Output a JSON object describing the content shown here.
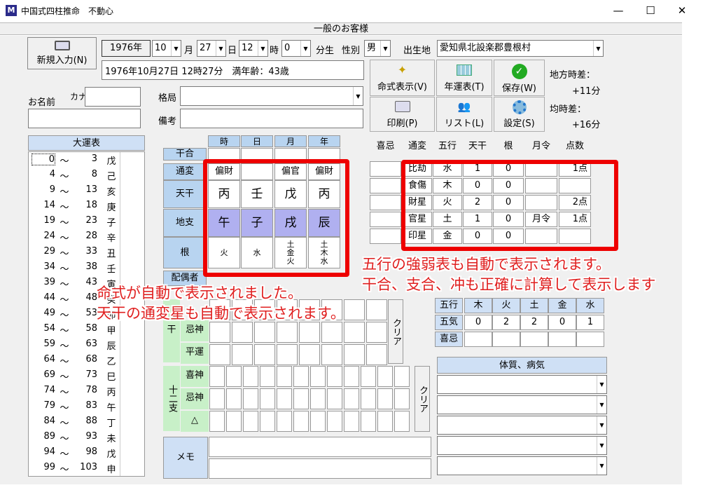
{
  "window": {
    "title": "中国式四柱推命　不動心",
    "logo": "M",
    "minimize": "—",
    "maximize": "☐",
    "close": "✕"
  },
  "header": {
    "title": "一般のお客様"
  },
  "new_button": {
    "label": "新規入力(N)"
  },
  "birth": {
    "year": "1976年",
    "month": "10",
    "month_unit": "月",
    "day": "27",
    "day_unit": "日",
    "hour": "12",
    "hour_unit": "時",
    "minute": "0",
    "minute_unit": "分生",
    "gender_label": "性別",
    "gender": "男",
    "place_label": "出生地",
    "place": "愛知県北設楽郡豊根村",
    "summary": "1976年10月27日 12時27分　満年齢：43歳"
  },
  "toolbar": {
    "meishiki": "命式表示(V)",
    "nenun": "年運表(T)",
    "save": "保存(W)",
    "print": "印刷(P)",
    "list": "リスト(L)",
    "settings": "設定(S)"
  },
  "time_diff": {
    "local_label": "地方時差：",
    "local_value": "+11分",
    "equation_label": "均時差：",
    "equation_value": "+16分"
  },
  "name": {
    "label": "お名前",
    "kana_label": "カナ",
    "kakkyoku_label": "格局",
    "biko_label": "備考"
  },
  "daiun": {
    "title": "大運表",
    "rows": [
      {
        "a": "0",
        "t": "～",
        "b": "3",
        "s": "戊"
      },
      {
        "a": "4",
        "t": "～",
        "b": "8",
        "s": "己"
      },
      {
        "a": "9",
        "t": "～",
        "b": "13",
        "s": "亥"
      },
      {
        "a": "14",
        "t": "～",
        "b": "18",
        "s": "庚"
      },
      {
        "a": "19",
        "t": "～",
        "b": "23",
        "s": "子"
      },
      {
        "a": "24",
        "t": "～",
        "b": "28",
        "s": "辛"
      },
      {
        "a": "29",
        "t": "～",
        "b": "33",
        "s": "丑"
      },
      {
        "a": "34",
        "t": "～",
        "b": "38",
        "s": "壬"
      },
      {
        "a": "39",
        "t": "～",
        "b": "43",
        "s": "寅"
      },
      {
        "a": "44",
        "t": "～",
        "b": "48",
        "s": "癸"
      },
      {
        "a": "49",
        "t": "～",
        "b": "53",
        "s": "卯"
      },
      {
        "a": "54",
        "t": "～",
        "b": "58",
        "s": "甲"
      },
      {
        "a": "59",
        "t": "～",
        "b": "63",
        "s": "辰"
      },
      {
        "a": "64",
        "t": "～",
        "b": "68",
        "s": "乙"
      },
      {
        "a": "69",
        "t": "～",
        "b": "73",
        "s": "巳"
      },
      {
        "a": "74",
        "t": "～",
        "b": "78",
        "s": "丙"
      },
      {
        "a": "79",
        "t": "～",
        "b": "83",
        "s": "午"
      },
      {
        "a": "84",
        "t": "～",
        "b": "88",
        "s": "丁"
      },
      {
        "a": "89",
        "t": "～",
        "b": "93",
        "s": "未"
      },
      {
        "a": "94",
        "t": "～",
        "b": "98",
        "s": "戊"
      },
      {
        "a": "99",
        "t": "～",
        "b": "103",
        "s": "申"
      }
    ]
  },
  "meishiki": {
    "cols": [
      "時",
      "日",
      "月",
      "年"
    ],
    "row_labels": {
      "kango": "干合",
      "tsuhen": "通変",
      "tenkan": "天干",
      "chishi": "地支",
      "kon": "根",
      "haigu": "配偶者"
    },
    "tsuhen": [
      "偏財",
      "",
      "偏官",
      "偏財"
    ],
    "tenkan": [
      "丙",
      "壬",
      "戊",
      "丙"
    ],
    "chishi": [
      "午",
      "子",
      "戌",
      "辰"
    ],
    "kon": [
      "火",
      "水",
      "土\n金\n火",
      "土\n木\n水"
    ]
  },
  "gogyo_table": {
    "headers": [
      "喜忌",
      "通変",
      "五行",
      "天干",
      "根",
      "月令",
      "点数"
    ],
    "rows": [
      {
        "tsuhen": "比劫",
        "gogyo": "水",
        "tenkan": "1",
        "kon": "0",
        "getsurei": "",
        "points": "1点"
      },
      {
        "tsuhen": "食傷",
        "gogyo": "木",
        "tenkan": "0",
        "kon": "0",
        "getsurei": "",
        "points": ""
      },
      {
        "tsuhen": "財星",
        "gogyo": "火",
        "tenkan": "2",
        "kon": "0",
        "getsurei": "",
        "points": "2点"
      },
      {
        "tsuhen": "官星",
        "gogyo": "土",
        "tenkan": "1",
        "kon": "0",
        "getsurei": "月令",
        "points": "1点"
      },
      {
        "tsuhen": "印星",
        "gogyo": "金",
        "tenkan": "0",
        "kon": "0",
        "getsurei": "",
        "points": ""
      }
    ]
  },
  "gogyo_summary": {
    "headers": [
      "五行",
      "木",
      "火",
      "土",
      "金",
      "水"
    ],
    "goki_label": "五気",
    "goki": [
      "0",
      "2",
      "2",
      "0",
      "1"
    ],
    "kiki_label": "喜忌"
  },
  "kishin": {
    "kanshi_label": "干",
    "kishin": "喜神",
    "kijin": "忌神",
    "heiun": "平運",
    "juuni_label": "十二支",
    "triangle": "△",
    "clear": "クリア"
  },
  "memo": {
    "label": "メモ"
  },
  "taishitsu": {
    "title": "体質、病気"
  },
  "annotations": {
    "left1": "命式が自動で表示されました。",
    "left2": "天干の通変星も自動で表示されます。",
    "right1": "五行の強弱表も自動で表示されます。",
    "right2": "干合、支合、冲も正確に計算して表示します"
  },
  "colors": {
    "accent_red": "#e00000",
    "header_blue": "#b8d4f0",
    "purple": "#b0b0f0",
    "green": "#c8f0c8"
  }
}
